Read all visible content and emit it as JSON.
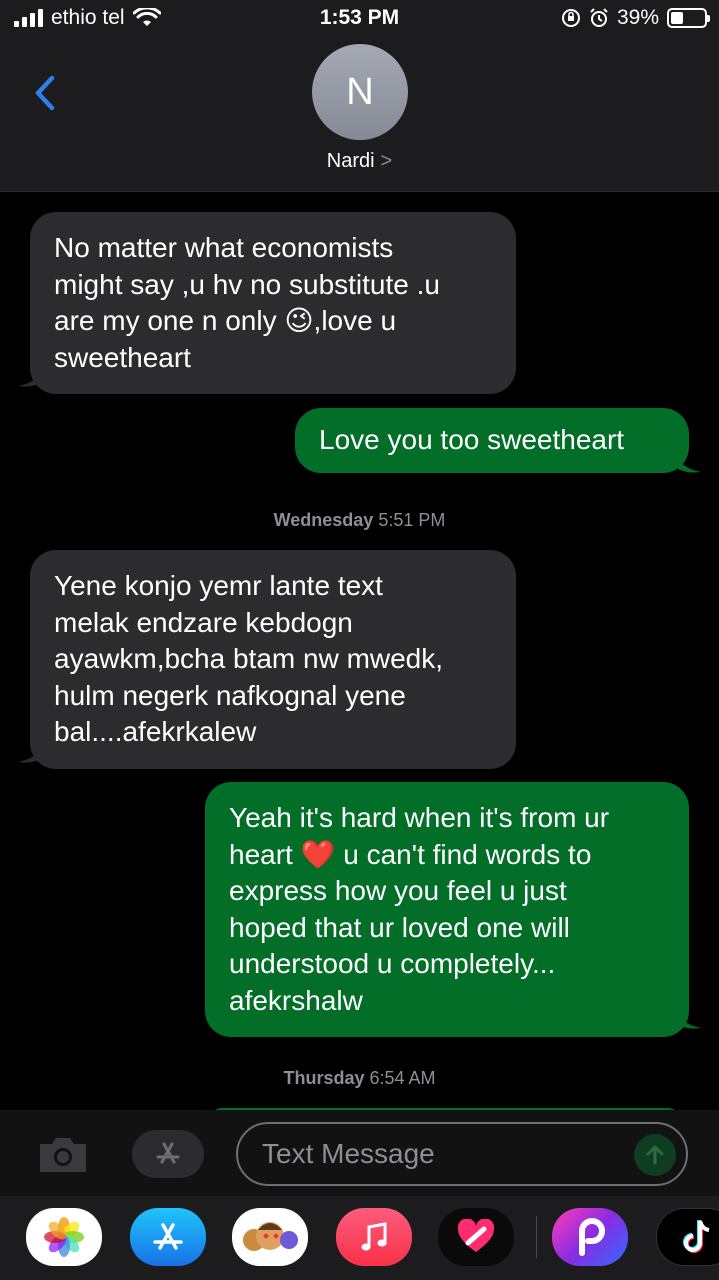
{
  "status_bar": {
    "carrier": "ethio tel",
    "time": "1:53 PM",
    "battery": "39%",
    "battery_level": 0.39,
    "icons": [
      "signal-icon",
      "wifi-icon",
      "rotation-lock-icon",
      "alarm-icon",
      "battery-icon"
    ]
  },
  "header": {
    "back_icon": "chevron-left-icon",
    "avatar_initial": "N",
    "contact_name": "Nardi",
    "contact_chevron": ">"
  },
  "messages": [
    {
      "direction": "incoming",
      "lines": [
        "No matter what economists",
        "might say ,u hv no substitute .u",
        "are my one n only 😉,love u",
        "sweetheart"
      ]
    },
    {
      "direction": "outgoing",
      "lines": [
        "Love you too sweetheart"
      ]
    },
    {
      "type": "timestamp",
      "day": "Wednesday",
      "time": "5:51 PM"
    },
    {
      "direction": "incoming",
      "lines": [
        "Yene konjo yemr lante text",
        "melak endzare kebdogn",
        "ayawkm,bcha btam nw mwedk,",
        "hulm negerk nafkognal yene",
        "bal....afekrkalew"
      ]
    },
    {
      "direction": "outgoing",
      "lines": [
        "Yeah it's hard when it's from ur",
        "heart ❤️ u can't find words to",
        "express how you feel u just",
        "hoped that ur loved one will",
        "understood u completely...",
        "afekrshalw"
      ]
    },
    {
      "type": "timestamp",
      "day": "Thursday",
      "time": "6:54 AM"
    }
  ],
  "input_bar": {
    "placeholder": "Text Message",
    "camera_icon": "camera-icon",
    "apps_icon": "app-store-icon",
    "send_icon": "send-arrow-icon"
  },
  "app_drawer": {
    "apps": [
      "photos-icon",
      "app-store-icon",
      "memoji-icon",
      "music-icon",
      "digital-touch-icon",
      "picsart-icon",
      "tiktok-icon"
    ]
  },
  "colors": {
    "incoming_bubble": "#2c2c2e",
    "outgoing_bubble": "#026e27",
    "accent_blue": "#2f80ed",
    "background": "#000000",
    "bar": "#1c1c1e"
  }
}
